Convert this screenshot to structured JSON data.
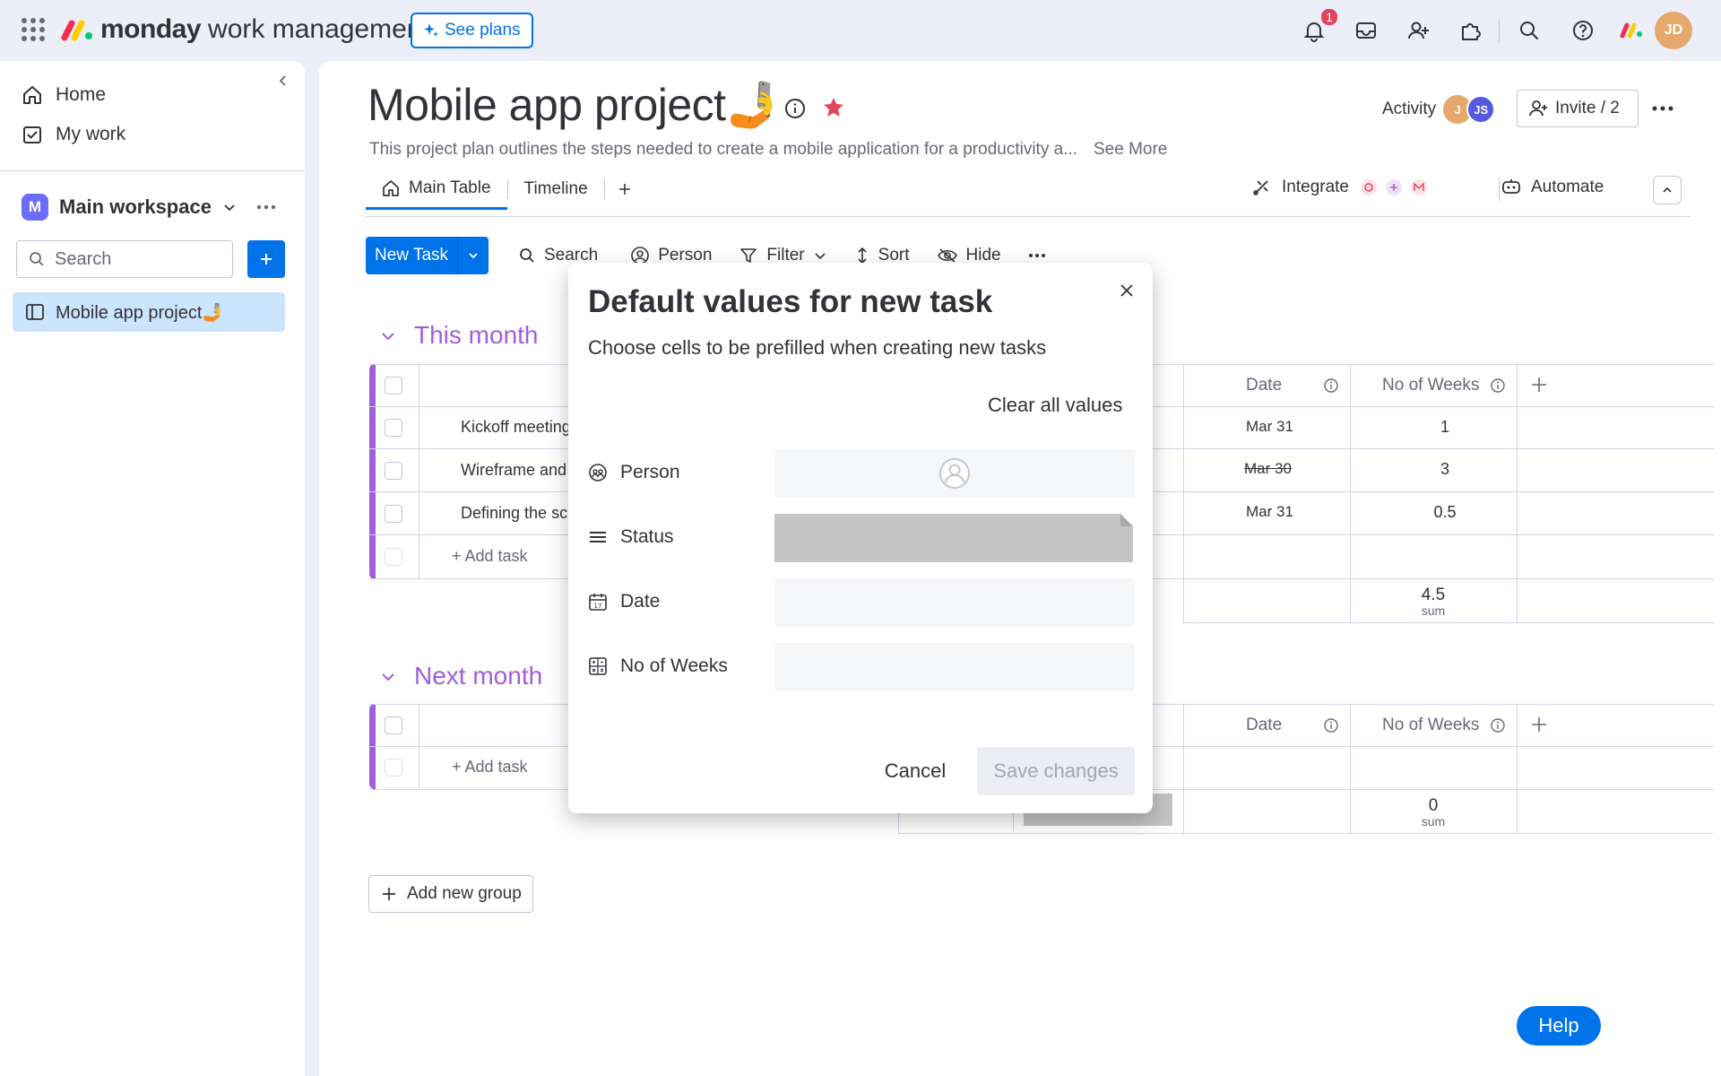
{
  "app": {
    "brand_bold": "monday",
    "brand_rest": "work management",
    "see_plans": "See plans",
    "notification_count": "1",
    "user_initials": "JD"
  },
  "sidebar": {
    "home": "Home",
    "my_work": "My work",
    "workspace_initial": "M",
    "workspace_name": "Main workspace",
    "search_placeholder": "Search",
    "board_item": "Mobile app project🤳"
  },
  "board": {
    "title": "Mobile app project🤳",
    "description": "This project plan outlines the steps needed to create a mobile application for a productivity a...",
    "see_more": "See More",
    "activity": "Activity",
    "activity_avatars": [
      "J",
      "JS"
    ],
    "invite": "Invite / 2",
    "tabs": [
      "Main Table",
      "Timeline"
    ],
    "integrate": "Integrate",
    "automate": "Automate"
  },
  "toolbar": {
    "new_task": "New Task",
    "search": "Search",
    "person": "Person",
    "filter": "Filter",
    "sort": "Sort",
    "hide": "Hide"
  },
  "groups": [
    {
      "title": "This month",
      "columns": {
        "date": "Date",
        "weeks": "No of Weeks"
      },
      "rows": [
        {
          "task": "Kickoff meeting",
          "date": "Mar 31",
          "weeks": "1"
        },
        {
          "task": "Wireframe and",
          "date": "Mar 30",
          "weeks": "3"
        },
        {
          "task": "Defining the sc",
          "date": "Mar 31",
          "weeks": "0.5"
        }
      ],
      "add_task": "+ Add task",
      "sum_value": "4.5",
      "sum_label": "sum"
    },
    {
      "title": "Next month",
      "columns": {
        "date": "Date",
        "weeks": "No of Weeks"
      },
      "rows": [],
      "add_task": "+ Add task",
      "sum_value": "0",
      "sum_label": "sum"
    }
  ],
  "add_group": "Add new group",
  "modal": {
    "title": "Default values for new task",
    "subtitle": "Choose cells to be prefilled when creating new tasks",
    "clear_all": "Clear all values",
    "fields": [
      {
        "label": "Person",
        "icon": "person-column-icon"
      },
      {
        "label": "Status",
        "icon": "status-column-icon"
      },
      {
        "label": "Date",
        "icon": "date-column-icon"
      },
      {
        "label": "No of Weeks",
        "icon": "numbers-column-icon"
      }
    ],
    "cancel": "Cancel",
    "save": "Save changes"
  },
  "help": "Help",
  "colors": {
    "primary": "#0073ea",
    "group_purple": "#a25ddc",
    "status_empty": "#c4c4c4",
    "favorite_orange": "#e2445c"
  }
}
